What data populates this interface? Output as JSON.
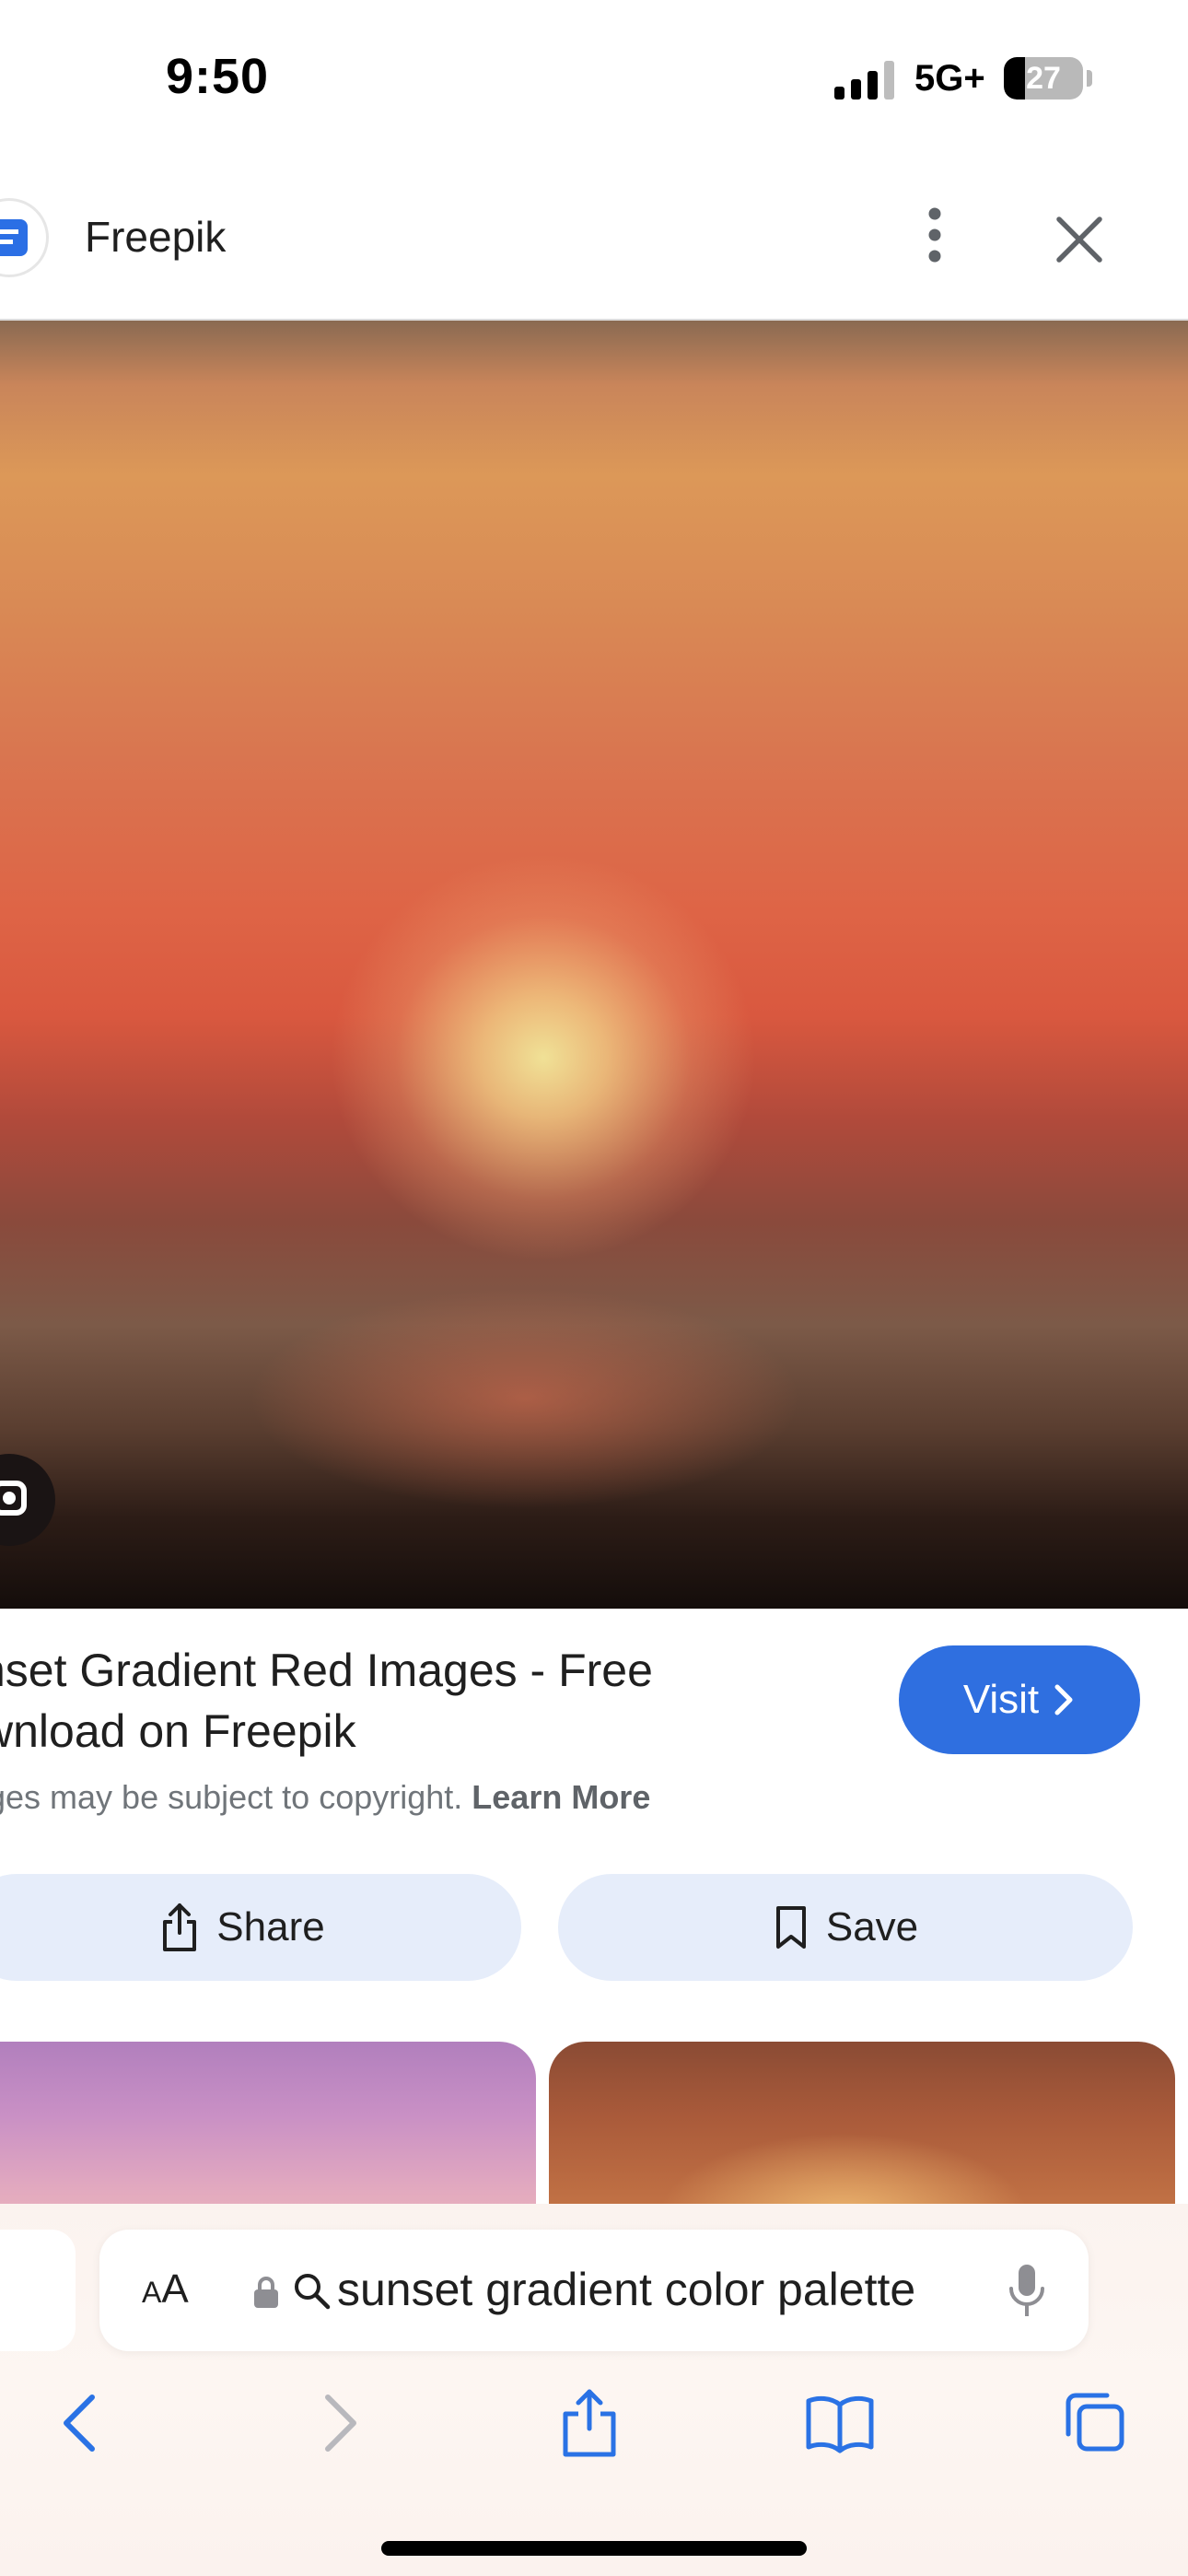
{
  "status_bar": {
    "time": "9:50",
    "network": "5G+",
    "battery_level": "27",
    "battery_fraction": 0.27
  },
  "header": {
    "site_name": "Freepik",
    "icons": [
      "freepik-logo",
      "more-vertical-icon",
      "close-icon"
    ]
  },
  "result": {
    "title": "nset Gradient Red Images - Free\nwnload on Freepik",
    "visit_label": "Visit",
    "copyright_text": "ges may be subject to copyright.",
    "learn_more_label": "Learn More",
    "share_label": "Share",
    "save_label": "Save"
  },
  "toolbar": {
    "text_size_small": "A",
    "text_size_large": "A",
    "address_text": "sunset gradient color palette"
  },
  "colors": {
    "accent_blue": "#2f6fe0",
    "action_bg": "#e6edfa",
    "ios_blue": "#2a72e5"
  }
}
